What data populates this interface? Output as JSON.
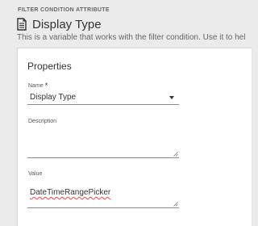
{
  "header": {
    "eyebrow": "FILTER CONDITION ATTRIBUTE",
    "title": "Display Type",
    "title_icon": "document-icon",
    "subtitle": "This is a variable that works with the filter condition. Use it to hel"
  },
  "panel": {
    "section_title": "Properties",
    "fields": {
      "name": {
        "label": "Name",
        "required_marker": "*",
        "value": "Display Type"
      },
      "description": {
        "label": "Description",
        "value": ""
      },
      "value": {
        "label": "Value",
        "value": "DateTimeRangePicker"
      }
    }
  }
}
